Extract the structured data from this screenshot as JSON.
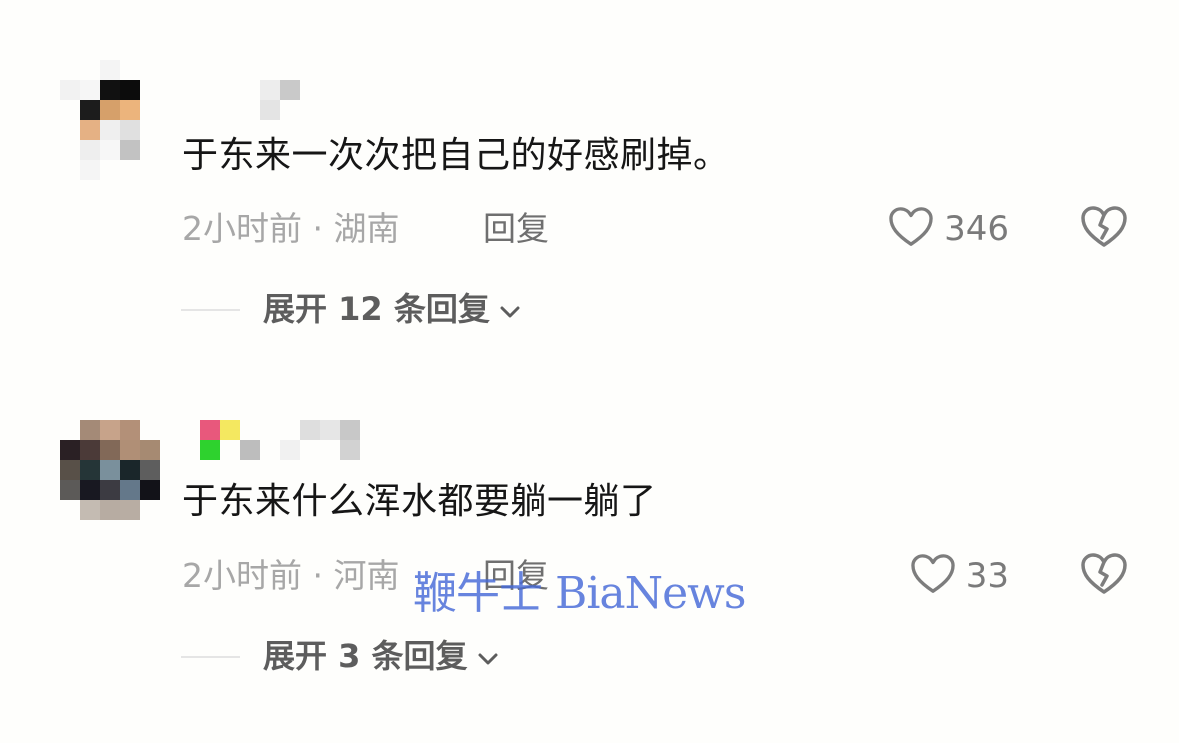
{
  "comments": [
    {
      "text": "于东来一次次把自己的好感刷掉。",
      "meta": "2小时前 · 湖南",
      "reply_label": "回复",
      "like_count": "346",
      "expand_label": "展开 12 条回复"
    },
    {
      "text": "于东来什么浑水都要躺一躺了",
      "meta": "2小时前 · 河南",
      "reply_label": "回复",
      "like_count": "33",
      "expand_label": "展开 3 条回复"
    }
  ],
  "watermark": "鞭牛士 BiaNews",
  "icons": {
    "like": "heart-outline-icon",
    "dislike": "broken-heart-icon",
    "expand": "chevron-down-icon"
  },
  "colors": {
    "background": "#fefefc",
    "text": "#161616",
    "meta": "#a7a7a7",
    "reply": "#6f6f6f",
    "watermark": "#4669d7"
  }
}
